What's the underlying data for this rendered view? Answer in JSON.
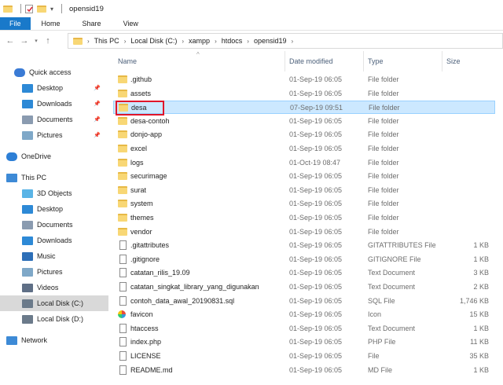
{
  "window": {
    "title": "opensid19"
  },
  "ribbon": {
    "tabs": [
      "File",
      "Home",
      "Share",
      "View"
    ]
  },
  "address": {
    "breadcrumbs": [
      "This PC",
      "Local Disk (C:)",
      "xampp",
      "htdocs",
      "opensid19"
    ]
  },
  "columns": {
    "name": "Name",
    "date": "Date modified",
    "type": "Type",
    "size": "Size"
  },
  "sidebar": {
    "items": [
      {
        "label": "Quick access",
        "icon": "star-icon"
      },
      {
        "label": "Desktop",
        "icon": "desktop-icon",
        "pinned": true
      },
      {
        "label": "Downloads",
        "icon": "download-icon",
        "pinned": true
      },
      {
        "label": "Documents",
        "icon": "documents-icon",
        "pinned": true
      },
      {
        "label": "Pictures",
        "icon": "pictures-icon",
        "pinned": true
      },
      {
        "label": "OneDrive",
        "icon": "cloud-icon"
      },
      {
        "label": "This PC",
        "icon": "computer-icon"
      },
      {
        "label": "3D Objects",
        "icon": "cube-icon"
      },
      {
        "label": "Desktop",
        "icon": "desktop-icon"
      },
      {
        "label": "Documents",
        "icon": "documents-icon"
      },
      {
        "label": "Downloads",
        "icon": "download-icon"
      },
      {
        "label": "Music",
        "icon": "music-icon"
      },
      {
        "label": "Pictures",
        "icon": "pictures-icon"
      },
      {
        "label": "Videos",
        "icon": "videos-icon"
      },
      {
        "label": "Local Disk (C:)",
        "icon": "drive-icon",
        "selected": true
      },
      {
        "label": "Local Disk (D:)",
        "icon": "drive-icon"
      },
      {
        "label": "Network",
        "icon": "network-icon"
      }
    ]
  },
  "files": [
    {
      "name": ".github",
      "date": "01-Sep-19 06:05",
      "type": "File folder",
      "size": "",
      "kind": "folder"
    },
    {
      "name": "assets",
      "date": "01-Sep-19 06:05",
      "type": "File folder",
      "size": "",
      "kind": "folder"
    },
    {
      "name": "desa",
      "date": "07-Sep-19 09:51",
      "type": "File folder",
      "size": "",
      "kind": "folder",
      "selected": true
    },
    {
      "name": "desa-contoh",
      "date": "01-Sep-19 06:05",
      "type": "File folder",
      "size": "",
      "kind": "folder"
    },
    {
      "name": "donjo-app",
      "date": "01-Sep-19 06:05",
      "type": "File folder",
      "size": "",
      "kind": "folder"
    },
    {
      "name": "excel",
      "date": "01-Sep-19 06:05",
      "type": "File folder",
      "size": "",
      "kind": "folder"
    },
    {
      "name": "logs",
      "date": "01-Oct-19 08:47",
      "type": "File folder",
      "size": "",
      "kind": "folder"
    },
    {
      "name": "securimage",
      "date": "01-Sep-19 06:05",
      "type": "File folder",
      "size": "",
      "kind": "folder"
    },
    {
      "name": "surat",
      "date": "01-Sep-19 06:05",
      "type": "File folder",
      "size": "",
      "kind": "folder"
    },
    {
      "name": "system",
      "date": "01-Sep-19 06:05",
      "type": "File folder",
      "size": "",
      "kind": "folder"
    },
    {
      "name": "themes",
      "date": "01-Sep-19 06:05",
      "type": "File folder",
      "size": "",
      "kind": "folder"
    },
    {
      "name": "vendor",
      "date": "01-Sep-19 06:05",
      "type": "File folder",
      "size": "",
      "kind": "folder"
    },
    {
      "name": ".gitattributes",
      "date": "01-Sep-19 06:05",
      "type": "GITATTRIBUTES File",
      "size": "1 KB",
      "kind": "file"
    },
    {
      "name": ".gitignore",
      "date": "01-Sep-19 06:05",
      "type": "GITIGNORE File",
      "size": "1 KB",
      "kind": "file"
    },
    {
      "name": "catatan_rilis_19.09",
      "date": "01-Sep-19 06:05",
      "type": "Text Document",
      "size": "3 KB",
      "kind": "file"
    },
    {
      "name": "catatan_singkat_library_yang_digunakan",
      "date": "01-Sep-19 06:05",
      "type": "Text Document",
      "size": "2 KB",
      "kind": "file"
    },
    {
      "name": "contoh_data_awal_20190831.sql",
      "date": "01-Sep-19 06:05",
      "type": "SQL File",
      "size": "1,746 KB",
      "kind": "file"
    },
    {
      "name": "favicon",
      "date": "01-Sep-19 06:05",
      "type": "Icon",
      "size": "15 KB",
      "kind": "icon"
    },
    {
      "name": "htaccess",
      "date": "01-Sep-19 06:05",
      "type": "Text Document",
      "size": "1 KB",
      "kind": "file"
    },
    {
      "name": "index.php",
      "date": "01-Sep-19 06:05",
      "type": "PHP File",
      "size": "11 KB",
      "kind": "file"
    },
    {
      "name": "LICENSE",
      "date": "01-Sep-19 06:05",
      "type": "File",
      "size": "35 KB",
      "kind": "file"
    },
    {
      "name": "README.md",
      "date": "01-Sep-19 06:05",
      "type": "MD File",
      "size": "1 KB",
      "kind": "file"
    }
  ]
}
